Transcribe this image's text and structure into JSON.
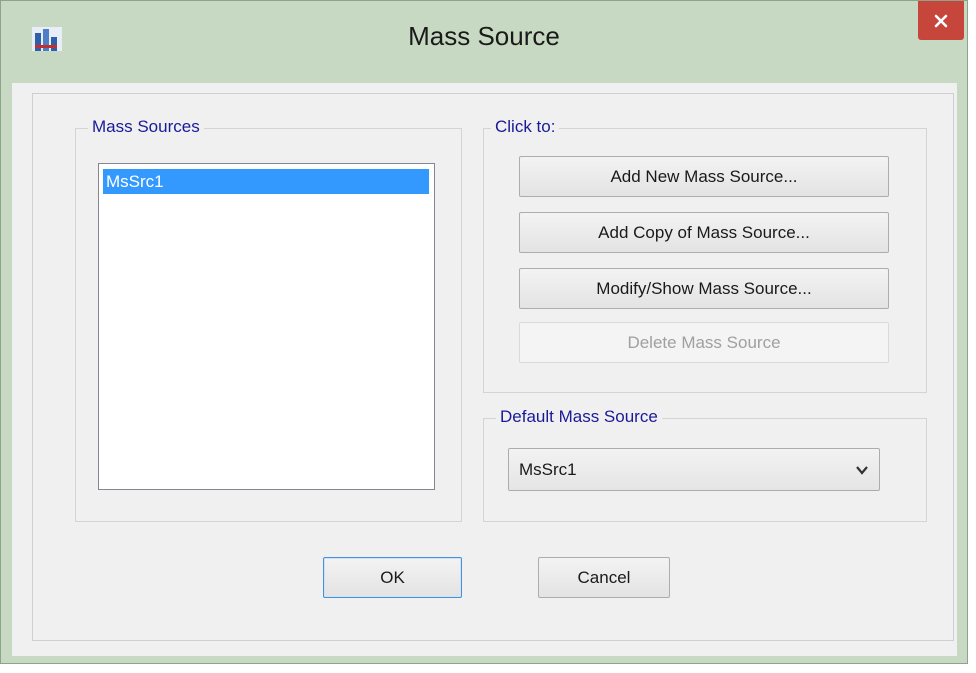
{
  "window": {
    "title": "Mass Source",
    "icon": "app-icon",
    "close_icon": "close-icon"
  },
  "mass_sources_group": {
    "label": "Mass Sources",
    "items": [
      "MsSrc1"
    ],
    "selected": "MsSrc1"
  },
  "actions_group": {
    "label": "Click to:",
    "buttons": {
      "add_new": "Add New Mass Source...",
      "add_copy": "Add Copy of Mass Source...",
      "modify_show": "Modify/Show Mass Source...",
      "delete": "Delete Mass Source"
    }
  },
  "default_group": {
    "label": "Default Mass Source",
    "selected": "MsSrc1"
  },
  "footer": {
    "ok": "OK",
    "cancel": "Cancel"
  },
  "colors": {
    "frame": "#c8d9c3",
    "close_button": "#c7463b",
    "selection": "#3399ff",
    "group_label": "#1a1a99"
  }
}
